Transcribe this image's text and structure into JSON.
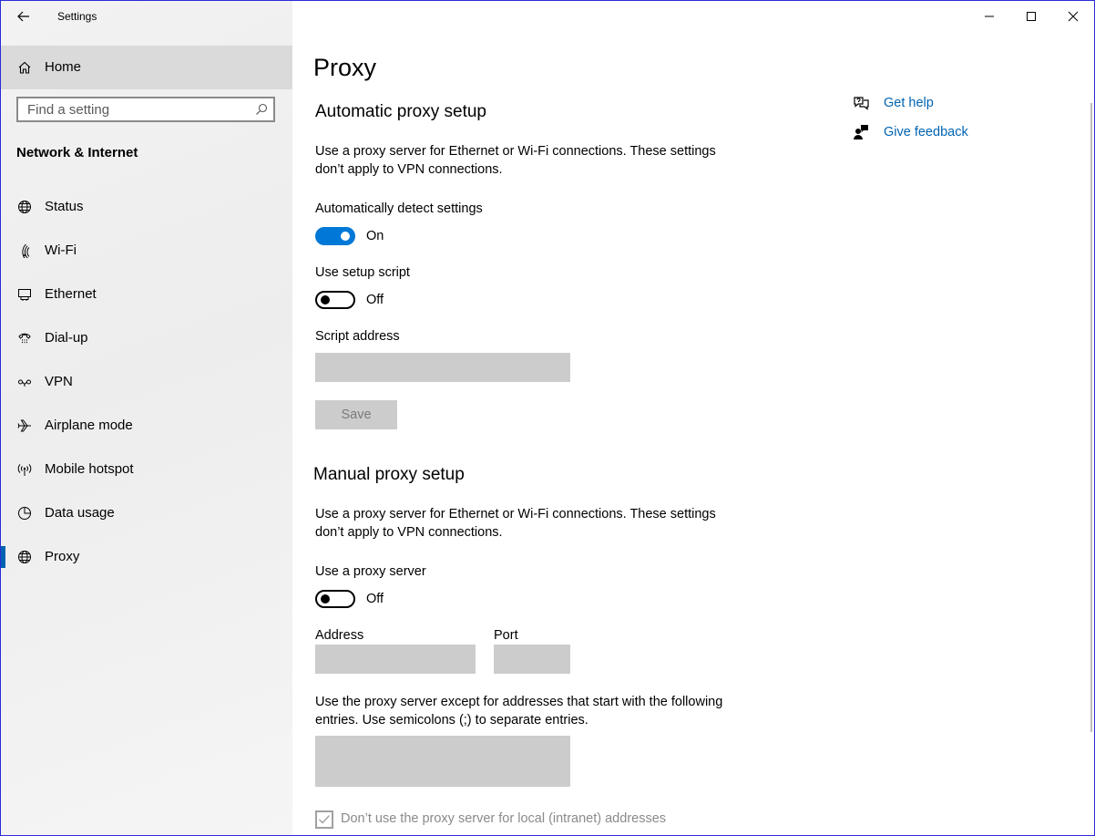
{
  "app_title": "Settings",
  "window_controls": {
    "minimize": "—",
    "maximize": "☐",
    "close": "✕"
  },
  "sidebar": {
    "home_label": "Home",
    "search_placeholder": "Find a setting",
    "section_title": "Network & Internet",
    "items": [
      {
        "label": "Status",
        "icon": "globe-status-icon"
      },
      {
        "label": "Wi-Fi",
        "icon": "wifi-icon"
      },
      {
        "label": "Ethernet",
        "icon": "ethernet-icon"
      },
      {
        "label": "Dial-up",
        "icon": "dialup-icon"
      },
      {
        "label": "VPN",
        "icon": "vpn-icon"
      },
      {
        "label": "Airplane mode",
        "icon": "airplane-icon"
      },
      {
        "label": "Mobile hotspot",
        "icon": "hotspot-icon"
      },
      {
        "label": "Data usage",
        "icon": "data-usage-icon"
      },
      {
        "label": "Proxy",
        "icon": "globe-icon",
        "selected": true
      }
    ]
  },
  "main": {
    "page_title": "Proxy",
    "automatic": {
      "heading": "Automatic proxy setup",
      "description": "Use a proxy server for Ethernet or Wi-Fi connections. These settings don’t apply to VPN connections.",
      "detect_label": "Automatically detect settings",
      "detect_state": "On",
      "script_label": "Use setup script",
      "script_state": "Off",
      "script_address_label": "Script address",
      "script_address_value": "",
      "save_label": "Save"
    },
    "manual": {
      "heading": "Manual proxy setup",
      "description": "Use a proxy server for Ethernet or Wi-Fi connections. These settings don’t apply to VPN connections.",
      "use_proxy_label": "Use a proxy server",
      "use_proxy_state": "Off",
      "address_label": "Address",
      "address_value": "",
      "port_label": "Port",
      "port_value": "",
      "exceptions_description": "Use the proxy server except for addresses that start with the following entries. Use semicolons (;) to separate entries.",
      "exceptions_value": "",
      "local_checkbox_label": "Don’t use the proxy server for local (intranet) addresses",
      "local_checkbox_checked": true
    },
    "help": {
      "get_help": "Get help",
      "give_feedback": "Give feedback"
    }
  },
  "colors": {
    "accent": "#0078d7",
    "link": "#0063b1",
    "field_disabled": "#cccccc",
    "sidebar_bg": "#f2f2f2",
    "home_selected_bg": "#dadada"
  }
}
